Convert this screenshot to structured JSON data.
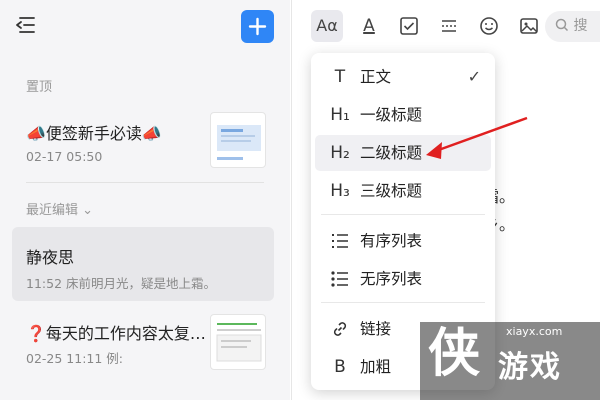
{
  "sidebar": {
    "section_pinned": "置顶",
    "section_recent": "最近编辑",
    "recent_chevron": "⌄",
    "notes": [
      {
        "title": "📣便签新手必读📣",
        "meta": "02-17 05:50"
      },
      {
        "title": "静夜思",
        "meta": "11:52 床前明月光，疑是地上霜。"
      },
      {
        "title": "❓每天的工作内容太复…",
        "meta": "02-25 11:11 例:"
      }
    ]
  },
  "toolbar": {
    "format_label": "Aα",
    "font_color_label": "A",
    "search_placeholder": "搜"
  },
  "editor": {
    "line1_tail": "霜。",
    "line2_tail": "乡。"
  },
  "format_menu": {
    "items": [
      {
        "icon": "T",
        "label": "正文",
        "checked": "✓"
      },
      {
        "icon": "H₁",
        "label": "一级标题"
      },
      {
        "icon": "H₂",
        "label": "二级标题"
      },
      {
        "icon": "H₃",
        "label": "三级标题"
      },
      {
        "icon": "ordered-list-icon",
        "label": "有序列表"
      },
      {
        "icon": "unordered-list-icon",
        "label": "无序列表"
      },
      {
        "icon": "link-icon",
        "label": "链接"
      },
      {
        "icon": "B",
        "label": "加粗"
      }
    ]
  },
  "watermark": {
    "logo": "侠",
    "url": "xiayx.com",
    "text": "游戏"
  },
  "colors": {
    "accent": "#2f86f6",
    "annotation_arrow": "#e02020"
  }
}
